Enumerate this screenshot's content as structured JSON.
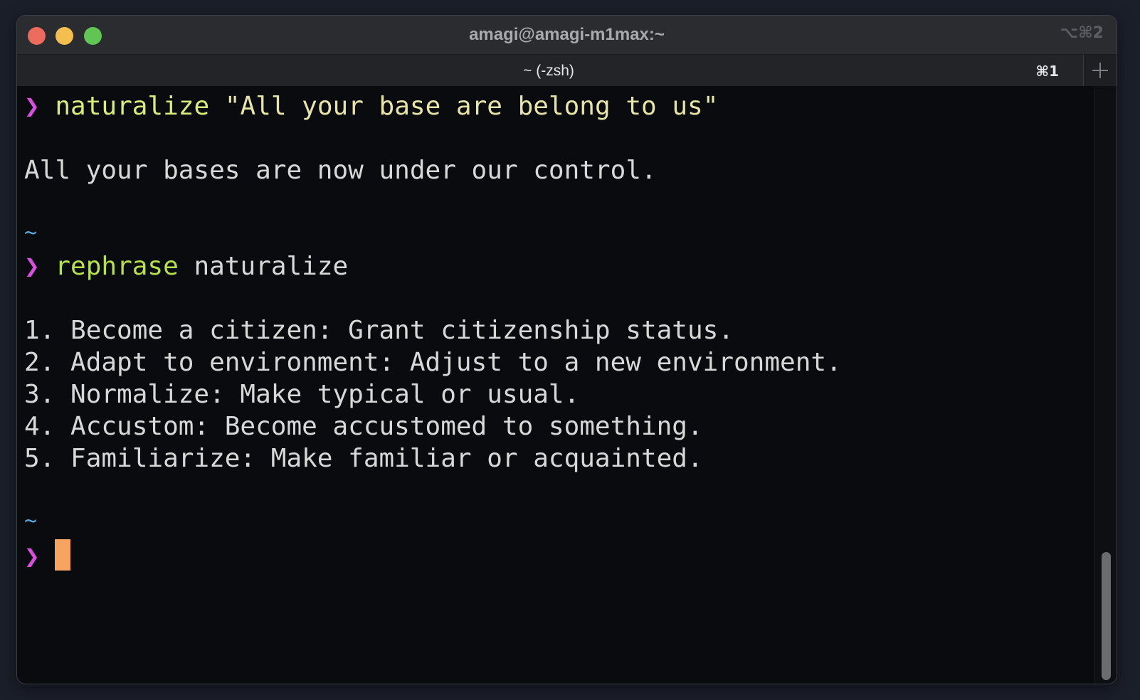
{
  "window": {
    "title": "amagi@amagi-m1max:~",
    "window_shortcut": "⌥⌘2"
  },
  "tabs": [
    {
      "label": "~ (-zsh)",
      "shortcut": "⌘1"
    }
  ],
  "colors": {
    "prompt": "#d94fe0",
    "command": "#d9ee7a",
    "cwd": "#5aa6d8",
    "cursor": "#f6a45f"
  },
  "terminal": {
    "prompt_symbol": "❯",
    "cwd": "~",
    "cmd1": {
      "command": "naturalize",
      "argument": "\"All your base are belong to us\""
    },
    "output1": "All your bases are now under our control.",
    "cmd2": {
      "command": "rephrase",
      "argument": "naturalize"
    },
    "output2": [
      "1. Become a citizen: Grant citizenship status.",
      "2. Adapt to environment: Adjust to a new environment.",
      "3. Normalize: Make typical or usual.",
      "4. Accustom: Become accustomed to something.",
      "5. Familiarize: Make familiar or acquainted."
    ]
  }
}
